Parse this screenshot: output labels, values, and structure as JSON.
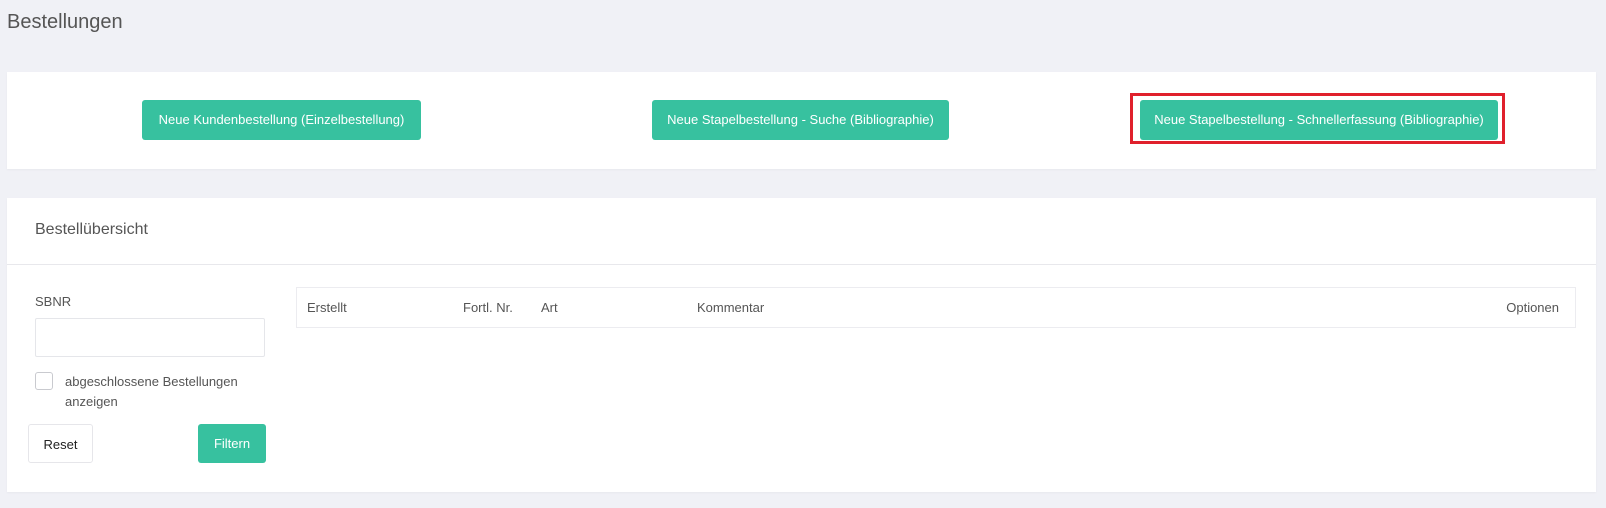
{
  "page": {
    "title": "Bestellungen"
  },
  "actions": {
    "new_customer_order": "Neue Kundenbestellung (Einzelbestellung)",
    "new_batch_search": "Neue Stapelbestellung - Suche (Bibliographie)",
    "new_batch_quick": "Neue Stapelbestellung - Schnellerfassung (Bibliographie)"
  },
  "overview": {
    "title": "Bestellübersicht",
    "filter": {
      "sbnr_label": "SBNR",
      "sbnr_value": "",
      "show_closed_label": "abgeschlossene Bestellungen anzeigen",
      "show_closed_checked": false,
      "reset_label": "Reset",
      "filter_label": "Filtern"
    },
    "table": {
      "columns": [
        "Erstellt",
        "Fortl. Nr.",
        "Art",
        "Kommentar",
        "Optionen"
      ],
      "rows": []
    }
  },
  "colors": {
    "accent": "#37c19f",
    "highlight": "#e0202c",
    "background": "#f0f1f6"
  }
}
